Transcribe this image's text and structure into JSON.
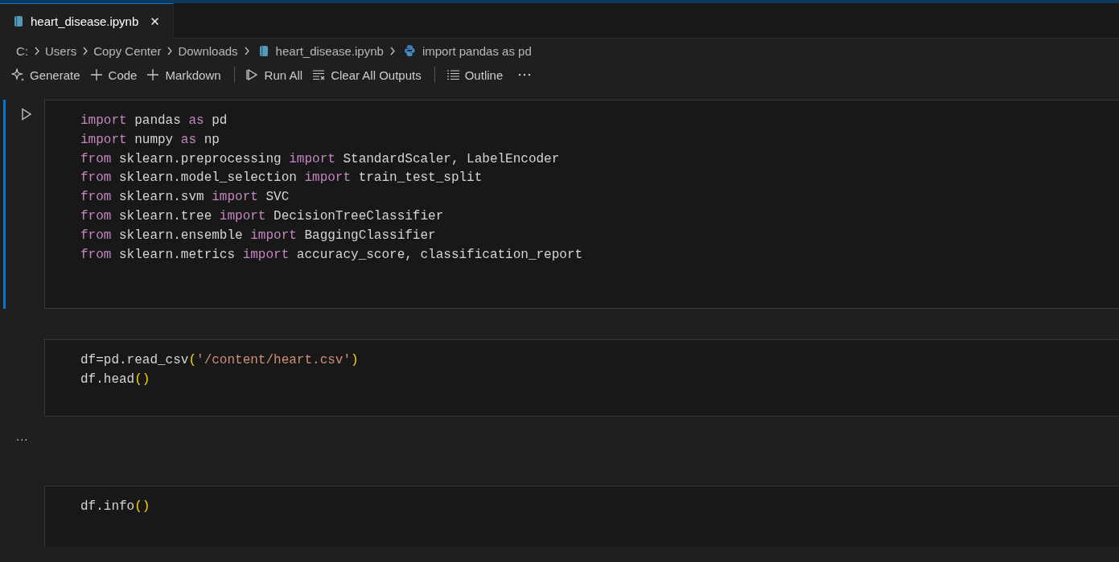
{
  "tabs": [
    {
      "label": "heart_disease.ipynb",
      "selected": true,
      "close": "✕"
    }
  ],
  "breadcrumbs": [
    {
      "kind": "folder",
      "label": "C:"
    },
    {
      "kind": "folder",
      "label": "Users"
    },
    {
      "kind": "folder",
      "label": "Copy Center"
    },
    {
      "kind": "folder",
      "label": "Downloads"
    },
    {
      "kind": "notebook",
      "label": "heart_disease.ipynb"
    },
    {
      "kind": "python",
      "label": "import pandas as pd"
    }
  ],
  "toolbar": [
    {
      "kind": "sparkle",
      "label": "Generate"
    },
    {
      "kind": "plus",
      "label": "Code"
    },
    {
      "kind": "plus",
      "label": "Markdown"
    },
    {
      "kind": "divider"
    },
    {
      "kind": "run",
      "label": "Run All"
    },
    {
      "kind": "clear",
      "label": "Clear All Outputs"
    },
    {
      "kind": "divider"
    },
    {
      "kind": "outline",
      "label": "Outline"
    },
    {
      "kind": "more"
    }
  ],
  "cells": [
    {
      "selected": true,
      "lines": [
        [
          {
            "kind": "keyword",
            "text": "import"
          },
          {
            "kind": "plain",
            "text": " pandas "
          },
          {
            "kind": "keyword",
            "text": "as"
          },
          {
            "kind": "plain",
            "text": " pd"
          }
        ],
        [
          {
            "kind": "keyword",
            "text": "import"
          },
          {
            "kind": "plain",
            "text": " numpy "
          },
          {
            "kind": "keyword",
            "text": "as"
          },
          {
            "kind": "plain",
            "text": " np"
          }
        ],
        [
          {
            "kind": "keyword",
            "text": "from"
          },
          {
            "kind": "plain",
            "text": " sklearn.preprocessing "
          },
          {
            "kind": "keyword",
            "text": "import"
          },
          {
            "kind": "plain",
            "text": " StandardScaler, LabelEncoder"
          }
        ],
        [
          {
            "kind": "keyword",
            "text": "from"
          },
          {
            "kind": "plain",
            "text": " sklearn.model_selection "
          },
          {
            "kind": "keyword",
            "text": "import"
          },
          {
            "kind": "plain",
            "text": " train_test_split"
          }
        ],
        [
          {
            "kind": "keyword",
            "text": "from"
          },
          {
            "kind": "plain",
            "text": " sklearn.svm "
          },
          {
            "kind": "keyword",
            "text": "import"
          },
          {
            "kind": "plain",
            "text": " SVC"
          }
        ],
        [
          {
            "kind": "keyword",
            "text": "from"
          },
          {
            "kind": "plain",
            "text": " sklearn.tree "
          },
          {
            "kind": "keyword",
            "text": "import"
          },
          {
            "kind": "plain",
            "text": " DecisionTreeClassifier"
          }
        ],
        [
          {
            "kind": "keyword",
            "text": "from"
          },
          {
            "kind": "plain",
            "text": " sklearn.ensemble "
          },
          {
            "kind": "keyword",
            "text": "import"
          },
          {
            "kind": "plain",
            "text": " BaggingClassifier"
          }
        ],
        [
          {
            "kind": "keyword",
            "text": "from"
          },
          {
            "kind": "plain",
            "text": " sklearn.metrics "
          },
          {
            "kind": "keyword",
            "text": "import"
          },
          {
            "kind": "plain",
            "text": " accuracy_score, classification_report"
          }
        ]
      ]
    },
    {
      "selected": false,
      "output_marker": "...",
      "lines": [
        [
          {
            "kind": "plain",
            "text": "df=pd.read_csv"
          },
          {
            "kind": "bracket",
            "text": "("
          },
          {
            "kind": "string",
            "text": "'/content/heart.csv'"
          },
          {
            "kind": "bracket",
            "text": ")"
          }
        ],
        [
          {
            "kind": "plain",
            "text": "df.head"
          },
          {
            "kind": "bracket",
            "text": "()"
          }
        ]
      ]
    },
    {
      "selected": false,
      "lines": [
        [
          {
            "kind": "plain",
            "text": "df.info"
          },
          {
            "kind": "bracket",
            "text": "()"
          }
        ]
      ]
    }
  ]
}
